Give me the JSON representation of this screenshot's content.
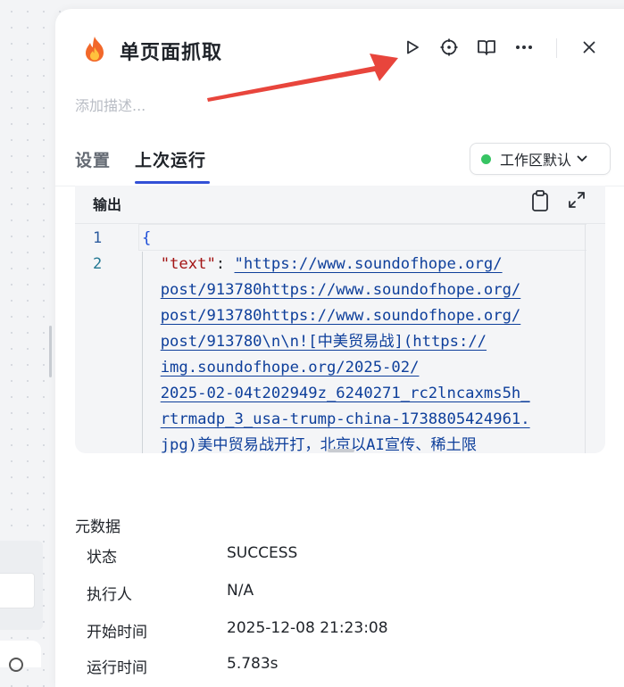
{
  "panel": {
    "title": "单页面抓取",
    "description_placeholder": "添加描述...",
    "tabs": [
      {
        "label": "设置",
        "active": false
      },
      {
        "label": "上次运行",
        "active": true
      }
    ],
    "workspace": {
      "label": "工作区默认",
      "status_color": "#37c463"
    },
    "header_icons": [
      "play-icon",
      "target-icon",
      "book-icon",
      "more-icon",
      "close-icon"
    ]
  },
  "output": {
    "title": "输出",
    "line_numbers": [
      "1",
      "2"
    ],
    "open_brace": "{",
    "key": "\"text\"",
    "colon": ": ",
    "value_lines": [
      "\"https://www.soundofhope.org/",
      "post/913780https://www.soundofhope.org/",
      "post/913780https://www.soundofhope.org/",
      "post/913780\\n\\n![中美贸易战](https://",
      "img.soundofhope.org/2025-02/",
      "2025-02-04t202949z_6240271_rc2lncaxms5h_",
      "rtrmadp_3_usa-trump-china-1738805424961.",
      "jpg)美中贸易战开打，北京以AI宣传、稀土限"
    ]
  },
  "metadata": {
    "title": "元数据",
    "rows": [
      {
        "label": "状态",
        "value": "SUCCESS"
      },
      {
        "label": "执行人",
        "value": "N/A"
      },
      {
        "label": "开始时间",
        "value": "2025-12-08 21:23:08"
      },
      {
        "label": "运行时间",
        "value": "5.783s"
      }
    ]
  },
  "colors": {
    "accent": "#3250d6",
    "annotation_arrow": "#e8453c",
    "flame": "#f2682a"
  }
}
